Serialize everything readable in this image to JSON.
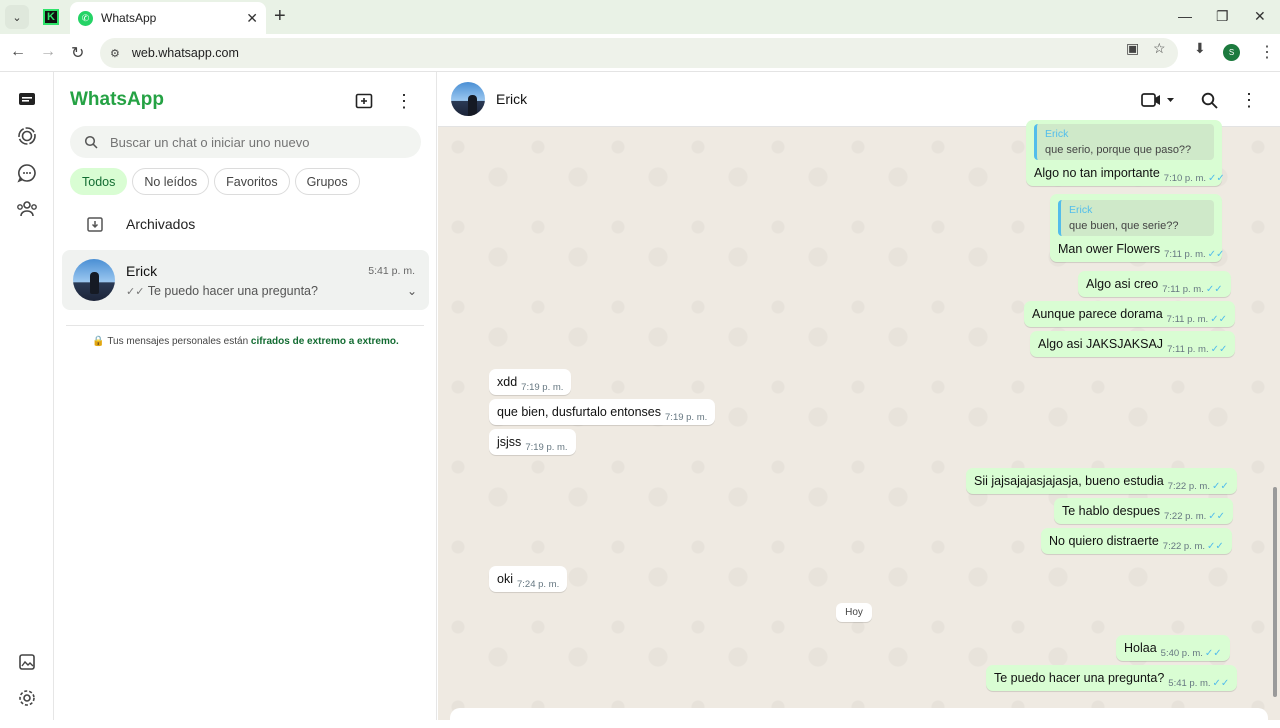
{
  "browser": {
    "tab_title": "WhatsApp",
    "url": "web.whatsapp.com",
    "profile_initial": "S"
  },
  "sidebar": {
    "brand": "WhatsApp",
    "search_placeholder": "Buscar un chat o iniciar uno nuevo",
    "filters": [
      "Todos",
      "No leídos",
      "Favoritos",
      "Grupos"
    ],
    "archived_label": "Archivados",
    "chat": {
      "name": "Erick",
      "time": "5:41 p. m.",
      "preview": "Te puedo hacer una pregunta?"
    },
    "e2e_text": "Tus mensajes personales están ",
    "e2e_link": "cifrados de extremo a extremo."
  },
  "conversation": {
    "contact_name": "Erick",
    "day_label": "Hoy",
    "messages": [
      {
        "dir": "out",
        "quote_name": "Erick",
        "quote_text": "que serio, porque que paso??",
        "text": "Algo no tan importante",
        "time": "7:10 p. m."
      },
      {
        "dir": "out",
        "quote_name": "Erick",
        "quote_text": "que buen, que serie??",
        "text": "Man ower Flowers",
        "time": "7:11 p. m."
      },
      {
        "dir": "out",
        "text": "Algo asi creo",
        "time": "7:11 p. m."
      },
      {
        "dir": "out",
        "text": "Aunque parece dorama",
        "time": "7:11 p. m."
      },
      {
        "dir": "out",
        "text": "Algo asi JAKSJAKSAJ",
        "time": "7:11 p. m."
      },
      {
        "dir": "in",
        "text": "xdd",
        "time": "7:19 p. m."
      },
      {
        "dir": "in",
        "text": "que bien, dusfurtalo entonses",
        "time": "7:19 p. m."
      },
      {
        "dir": "in",
        "text": "jsjss",
        "time": "7:19 p. m."
      },
      {
        "dir": "out",
        "text": "Sii jajsajajasjajasja, bueno estudia",
        "time": "7:22 p. m."
      },
      {
        "dir": "out",
        "text": "Te hablo despues",
        "time": "7:22 p. m."
      },
      {
        "dir": "out",
        "text": "No quiero distraerte",
        "time": "7:22 p. m."
      },
      {
        "dir": "in",
        "text": "oki",
        "time": "7:24 p. m."
      },
      {
        "dir": "out",
        "text": "Holaa",
        "time": "5:40 p. m."
      },
      {
        "dir": "out",
        "text": "Te puedo hacer una pregunta?",
        "time": "5:41 p. m."
      }
    ]
  },
  "colors": {
    "brand_green": "#25a244",
    "outgoing_bubble": "#d9fdd3",
    "incoming_bubble": "#ffffff",
    "read_ticks": "#53bdeb",
    "chat_bg": "#efeae2"
  }
}
